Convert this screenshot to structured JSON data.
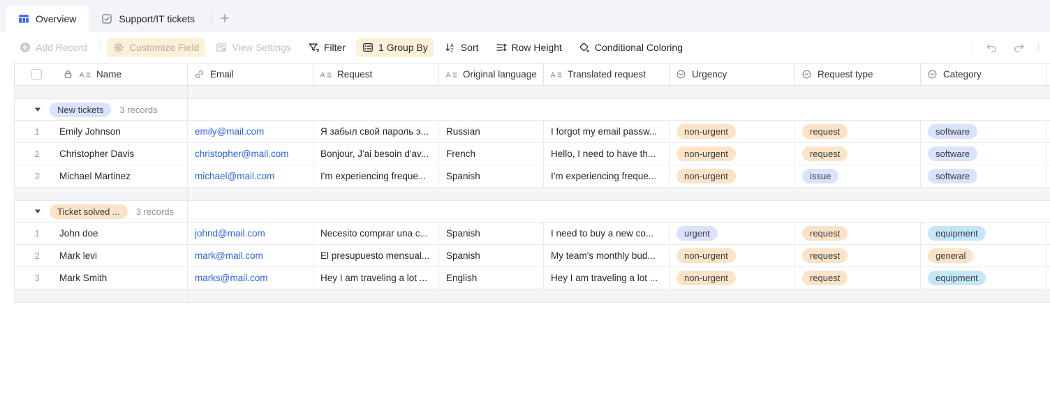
{
  "tabs": {
    "items": [
      {
        "label": "Overview",
        "active": true
      },
      {
        "label": "Support/IT tickets",
        "active": false
      }
    ]
  },
  "toolbar": {
    "add_record": "Add Record",
    "customize_field": "Customize Field",
    "view_settings": "View Settings",
    "filter": "Filter",
    "group_by": "1 Group By",
    "sort": "Sort",
    "row_height": "Row Height",
    "conditional_coloring": "Conditional Coloring"
  },
  "table": {
    "columns": [
      {
        "label": "Name",
        "type": "text",
        "locked": true
      },
      {
        "label": "Email",
        "type": "link"
      },
      {
        "label": "Request",
        "type": "text"
      },
      {
        "label": "Original language",
        "type": "text"
      },
      {
        "label": "Translated request",
        "type": "text"
      },
      {
        "label": "Urgency",
        "type": "select"
      },
      {
        "label": "Request type",
        "type": "select"
      },
      {
        "label": "Category",
        "type": "select"
      }
    ],
    "groups": [
      {
        "label": "New tickets",
        "label_color": "lavender",
        "count": "3 records",
        "rows": [
          {
            "num": "1",
            "name": "Emily Johnson",
            "email": "emily@mail.com",
            "request": "Я забыл свой пароль э...",
            "original_language": "Russian",
            "translated_request": "I forgot my email passw...",
            "urgency": {
              "text": "non-urgent",
              "color": "peach"
            },
            "request_type": {
              "text": "request",
              "color": "peach"
            },
            "category": {
              "text": "software",
              "color": "lavender"
            }
          },
          {
            "num": "2",
            "name": "Christopher Davis",
            "email": "christopher@mail.com",
            "request": "Bonjour, J'ai besoin d'av...",
            "original_language": "French",
            "translated_request": "Hello, I need to have th...",
            "urgency": {
              "text": "non-urgent",
              "color": "peach"
            },
            "request_type": {
              "text": "request",
              "color": "peach"
            },
            "category": {
              "text": "software",
              "color": "lavender"
            }
          },
          {
            "num": "3",
            "name": "Michael Martinez",
            "email": "michael@mail.com",
            "request": "I'm experiencing freque...",
            "original_language": "Spanish",
            "translated_request": "I'm experiencing freque...",
            "urgency": {
              "text": "non-urgent",
              "color": "peach"
            },
            "request_type": {
              "text": "issue",
              "color": "lavender"
            },
            "category": {
              "text": "software",
              "color": "lavender"
            }
          }
        ]
      },
      {
        "label": "Ticket solved ...",
        "label_color": "peach",
        "count": "3 records",
        "rows": [
          {
            "num": "1",
            "name": "John doe",
            "email": "johnd@mail.com",
            "request": "Necesito comprar una c...",
            "original_language": "Spanish",
            "translated_request": "I need to buy a new co...",
            "urgency": {
              "text": "urgent",
              "color": "lavender"
            },
            "request_type": {
              "text": "request",
              "color": "peach"
            },
            "category": {
              "text": "equipment",
              "color": "cyan"
            }
          },
          {
            "num": "2",
            "name": "Mark levi",
            "email": "mark@mail.com",
            "request": "El presupuesto mensual...",
            "original_language": "Spanish",
            "translated_request": "My team's monthly bud...",
            "urgency": {
              "text": "non-urgent",
              "color": "peach"
            },
            "request_type": {
              "text": "request",
              "color": "peach"
            },
            "category": {
              "text": "general",
              "color": "peach"
            }
          },
          {
            "num": "3",
            "name": "Mark Smith",
            "email": "marks@mail.com",
            "request": "Hey I am traveling a lot ...",
            "original_language": "English",
            "translated_request": "Hey I am traveling a lot ...",
            "urgency": {
              "text": "non-urgent",
              "color": "peach"
            },
            "request_type": {
              "text": "request",
              "color": "peach"
            },
            "category": {
              "text": "equipment",
              "color": "cyan"
            }
          }
        ]
      }
    ]
  },
  "colors": {
    "peach": "#fbe3c8",
    "lavender": "#dbe2fb",
    "cyan": "#c3e7f8",
    "accent_blue": "#3b68f0",
    "link_blue": "#2d63ea",
    "toolbar_highlight": "#fcf1d8"
  }
}
